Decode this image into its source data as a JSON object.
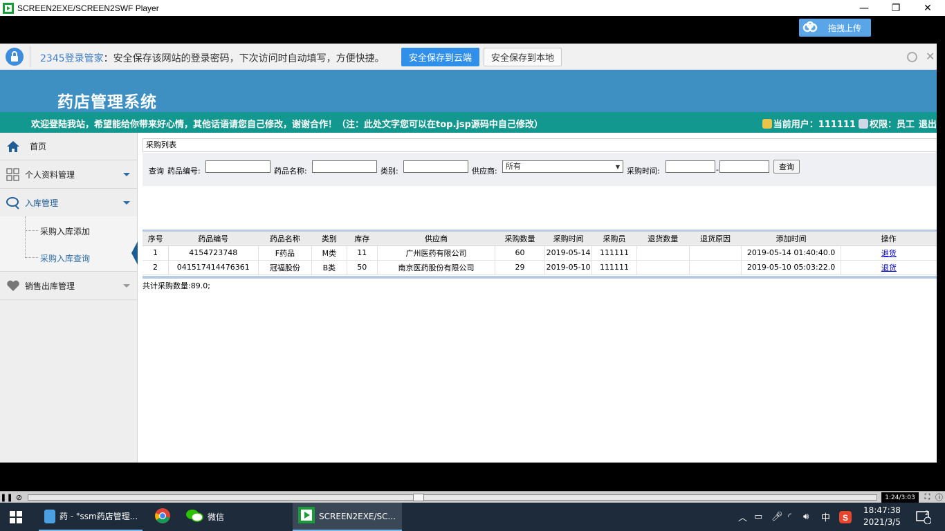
{
  "window": {
    "title": "SCREEN2EXE/SCREEN2SWF Player",
    "minimize": "—",
    "maximize": "❐",
    "close": "✕"
  },
  "upload_button": {
    "label": "拖拽上传"
  },
  "password_bar": {
    "brand": "2345登录管家",
    "message": "：安全保存该网站的登录密码，下次访问时自动填写，方便快捷。",
    "save_cloud": "安全保存到云端",
    "save_local": "安全保存到本地",
    "close": "✕"
  },
  "header": {
    "system_title": "药店管理系统",
    "welcome": "欢迎登陆我站，希望能给你带来好心情，其他话语请您自己修改，谢谢合作！（注：此处文字您可以在top.jsp源码中自己修改）",
    "current_user_label": "当前用户：111111",
    "permission_label": "权限：员工",
    "logout": "退出"
  },
  "sidebar": {
    "items": [
      {
        "label": "首页",
        "icon": "home-icon"
      },
      {
        "label": "个人资料管理",
        "icon": "grid-icon"
      },
      {
        "label": "入库管理",
        "icon": "chat-icon"
      },
      {
        "label": "销售出库管理",
        "icon": "heart-icon"
      }
    ],
    "sub_items": [
      {
        "label": "采购入库添加"
      },
      {
        "label": "采购入库查询"
      }
    ]
  },
  "panel": {
    "title": "采购列表"
  },
  "search": {
    "query_label": "查询",
    "drug_no_label": "药品编号:",
    "drug_no_value": "",
    "drug_name_label": "药品名称:",
    "drug_name_value": "",
    "category_label": "类别:",
    "category_value": "",
    "supplier_label": "供应商:",
    "supplier_selected": "所有",
    "purchase_time_label": "采购时间:",
    "time_from": "",
    "time_to": "",
    "time_separator": "-",
    "search_button": "查询"
  },
  "table": {
    "headers": [
      "序号",
      "药品编号",
      "药品名称",
      "类别",
      "库存",
      "供应商",
      "采购数量",
      "采购时间",
      "采购员",
      "退货数量",
      "退货原因",
      "添加时间",
      "操作"
    ],
    "rows": [
      [
        "1",
        "4154723748",
        "F药品",
        "M类",
        "11",
        "广州医药有限公司",
        "60",
        "2019-05-14",
        "111111",
        "",
        "",
        "2019-05-14 01:40:40.0",
        "退货"
      ],
      [
        "2",
        "041517414476361",
        "冠福股份",
        "B类",
        "50",
        "南京医药股份有限公司",
        "29",
        "2019-05-10",
        "111111",
        "",
        "",
        "2019-05-10 05:03:22.0",
        "退货"
      ]
    ],
    "total": "共计采购数量:89.0;"
  },
  "player": {
    "time": "1:24/3:03",
    "progress": 0.46
  },
  "taskbar": {
    "items": [
      {
        "label": "药 - \"ssm药店管理...",
        "icon": "file-icon"
      },
      {
        "label": "",
        "icon": "chrome-icon"
      },
      {
        "label": "微信",
        "icon": "wechat-icon"
      },
      {
        "label": "SCREEN2EXE/SC...",
        "icon": "screen2exe-icon"
      }
    ],
    "ime": "中",
    "time": "18:47:38",
    "date": "2021/3/5",
    "notifications": "2"
  }
}
